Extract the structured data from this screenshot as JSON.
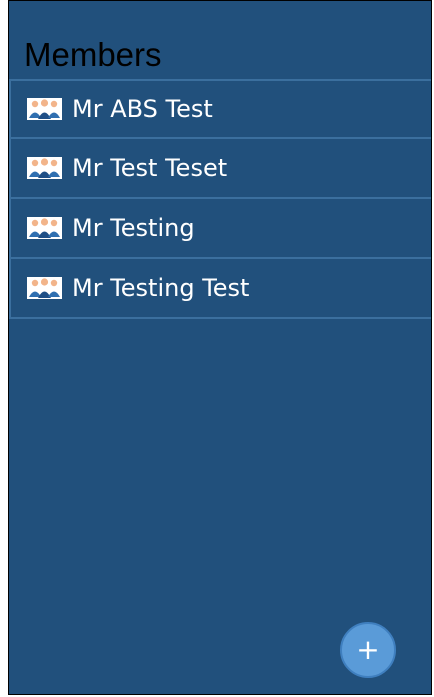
{
  "page": {
    "title": "Members"
  },
  "members": [
    {
      "name": "Mr ABS Test",
      "icon": "group-icon"
    },
    {
      "name": "Mr Test Teset",
      "icon": "group-icon"
    },
    {
      "name": "Mr Testing",
      "icon": "group-icon"
    },
    {
      "name": "Mr Testing Test",
      "icon": "group-icon"
    }
  ],
  "fab": {
    "label": "+",
    "icon": "plus-icon"
  },
  "colors": {
    "background": "#21507c",
    "row_border": "#3b6f9e",
    "fab": "#5a9bd8",
    "text": "#ffffff",
    "title": "#000000"
  }
}
